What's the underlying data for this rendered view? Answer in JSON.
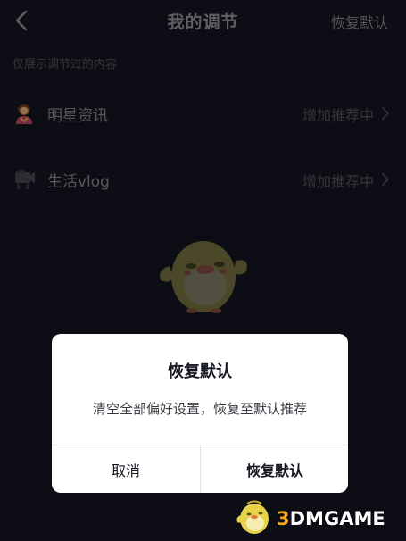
{
  "header": {
    "title": "我的调节",
    "reset_label": "恢复默认"
  },
  "hint": "仅展示调节过的内容",
  "items": [
    {
      "label": "明星资讯",
      "status": "增加推荐中",
      "icon": "star-person-icon"
    },
    {
      "label": "生活vlog",
      "status": "增加推荐中",
      "icon": "camera-icon"
    }
  ],
  "dialog": {
    "title": "恢复默认",
    "message": "清空全部偏好设置，恢复至默认推荐",
    "cancel_label": "取消",
    "confirm_label": "恢复默认"
  },
  "watermark": {
    "number": "3",
    "text": "DMGAME"
  },
  "colors": {
    "background": "#161823",
    "dialog_bg": "#ffffff",
    "watermark_accent": "#f5a623"
  }
}
